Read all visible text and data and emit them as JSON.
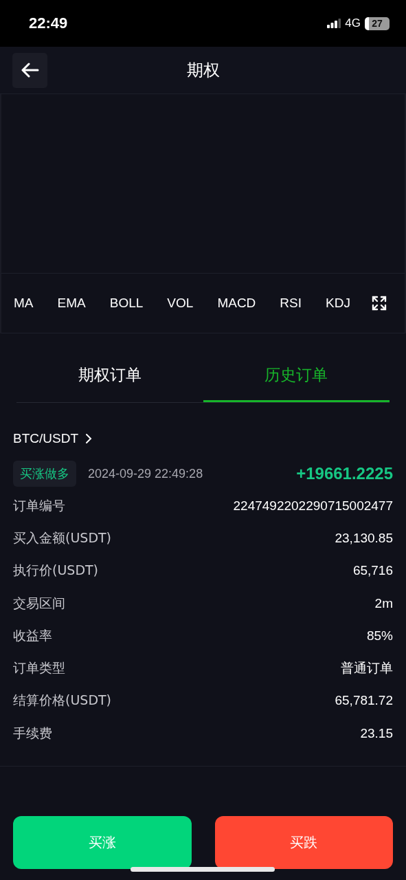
{
  "status_bar": {
    "time": "22:49",
    "network": "4G",
    "battery": "27"
  },
  "header": {
    "title": "期权"
  },
  "indicators": [
    {
      "label": "MA"
    },
    {
      "label": "EMA"
    },
    {
      "label": "BOLL"
    },
    {
      "label": "VOL"
    },
    {
      "label": "MACD"
    },
    {
      "label": "RSI"
    },
    {
      "label": "KDJ"
    }
  ],
  "tabs": [
    {
      "label": "期权订单",
      "selected": false
    },
    {
      "label": "历史订单",
      "selected": true
    }
  ],
  "orders": [
    {
      "pair": "BTC/USDT",
      "direction": {
        "label": "买涨做多",
        "kind": "up"
      },
      "time": "2024-09-29 22:49:28",
      "profit": {
        "value": "+19661.2225",
        "kind": "gain"
      },
      "fields": [
        {
          "label": "订单编号",
          "value": "2247492202290715002477"
        },
        {
          "label": "买入金额(USDT)",
          "value": "23,130.85"
        },
        {
          "label": "执行价(USDT)",
          "value": "65,716"
        },
        {
          "label": "交易区间",
          "value": "2m"
        },
        {
          "label": "收益率",
          "value": "85%"
        },
        {
          "label": "订单类型",
          "value": "普通订单"
        },
        {
          "label": "结算价格(USDT)",
          "value": "65,781.72"
        },
        {
          "label": "手续费",
          "value": "23.15"
        }
      ]
    }
  ],
  "actions": [
    {
      "label": "买涨",
      "kind": "buy"
    },
    {
      "label": "买跌",
      "kind": "sell"
    }
  ]
}
